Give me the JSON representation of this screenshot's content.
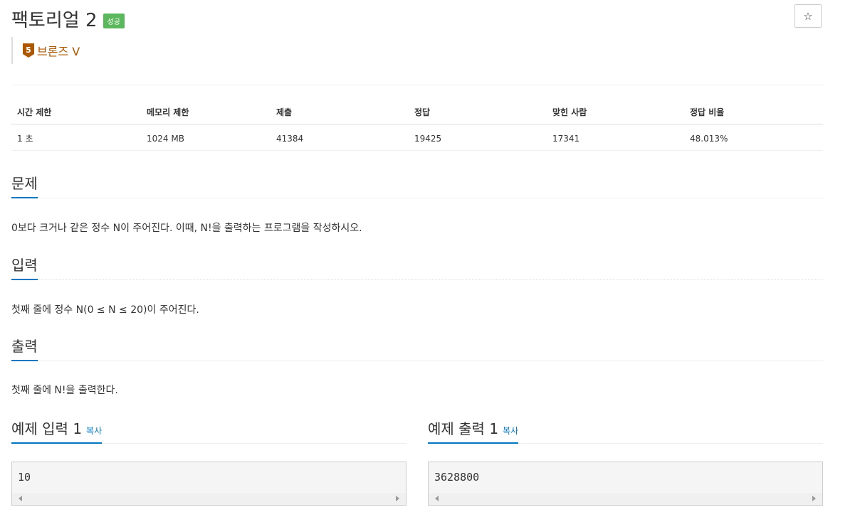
{
  "problem": {
    "title": "팩토리얼 2",
    "status_badge": "성공",
    "tier_number": "5",
    "tier_label": "브론즈 V",
    "tier_color": "#ad5600"
  },
  "actions": {
    "star_icon": "☆"
  },
  "stats": {
    "headers": [
      "시간 제한",
      "메모리 제한",
      "제출",
      "정답",
      "맞힌 사람",
      "정답 비율"
    ],
    "values": [
      "1 초",
      "1024 MB",
      "41384",
      "19425",
      "17341",
      "48.013%"
    ]
  },
  "sections": {
    "problem": {
      "heading": "문제",
      "body": "0보다 크거나 같은 정수 N이 주어진다. 이때, N!을 출력하는 프로그램을 작성하시오."
    },
    "input": {
      "heading": "입력",
      "body": "첫째 줄에 정수 N(0 ≤ N ≤ 20)이 주어진다."
    },
    "output": {
      "heading": "출력",
      "body": "첫째 줄에 N!을 출력한다."
    }
  },
  "samples": {
    "input": {
      "heading": "예제 입력 1",
      "copy_label": "복사",
      "value": "10"
    },
    "output": {
      "heading": "예제 출력 1",
      "copy_label": "복사",
      "value": "3628800"
    }
  },
  "colors": {
    "accent": "#0076c0",
    "success": "#5cb85c"
  }
}
